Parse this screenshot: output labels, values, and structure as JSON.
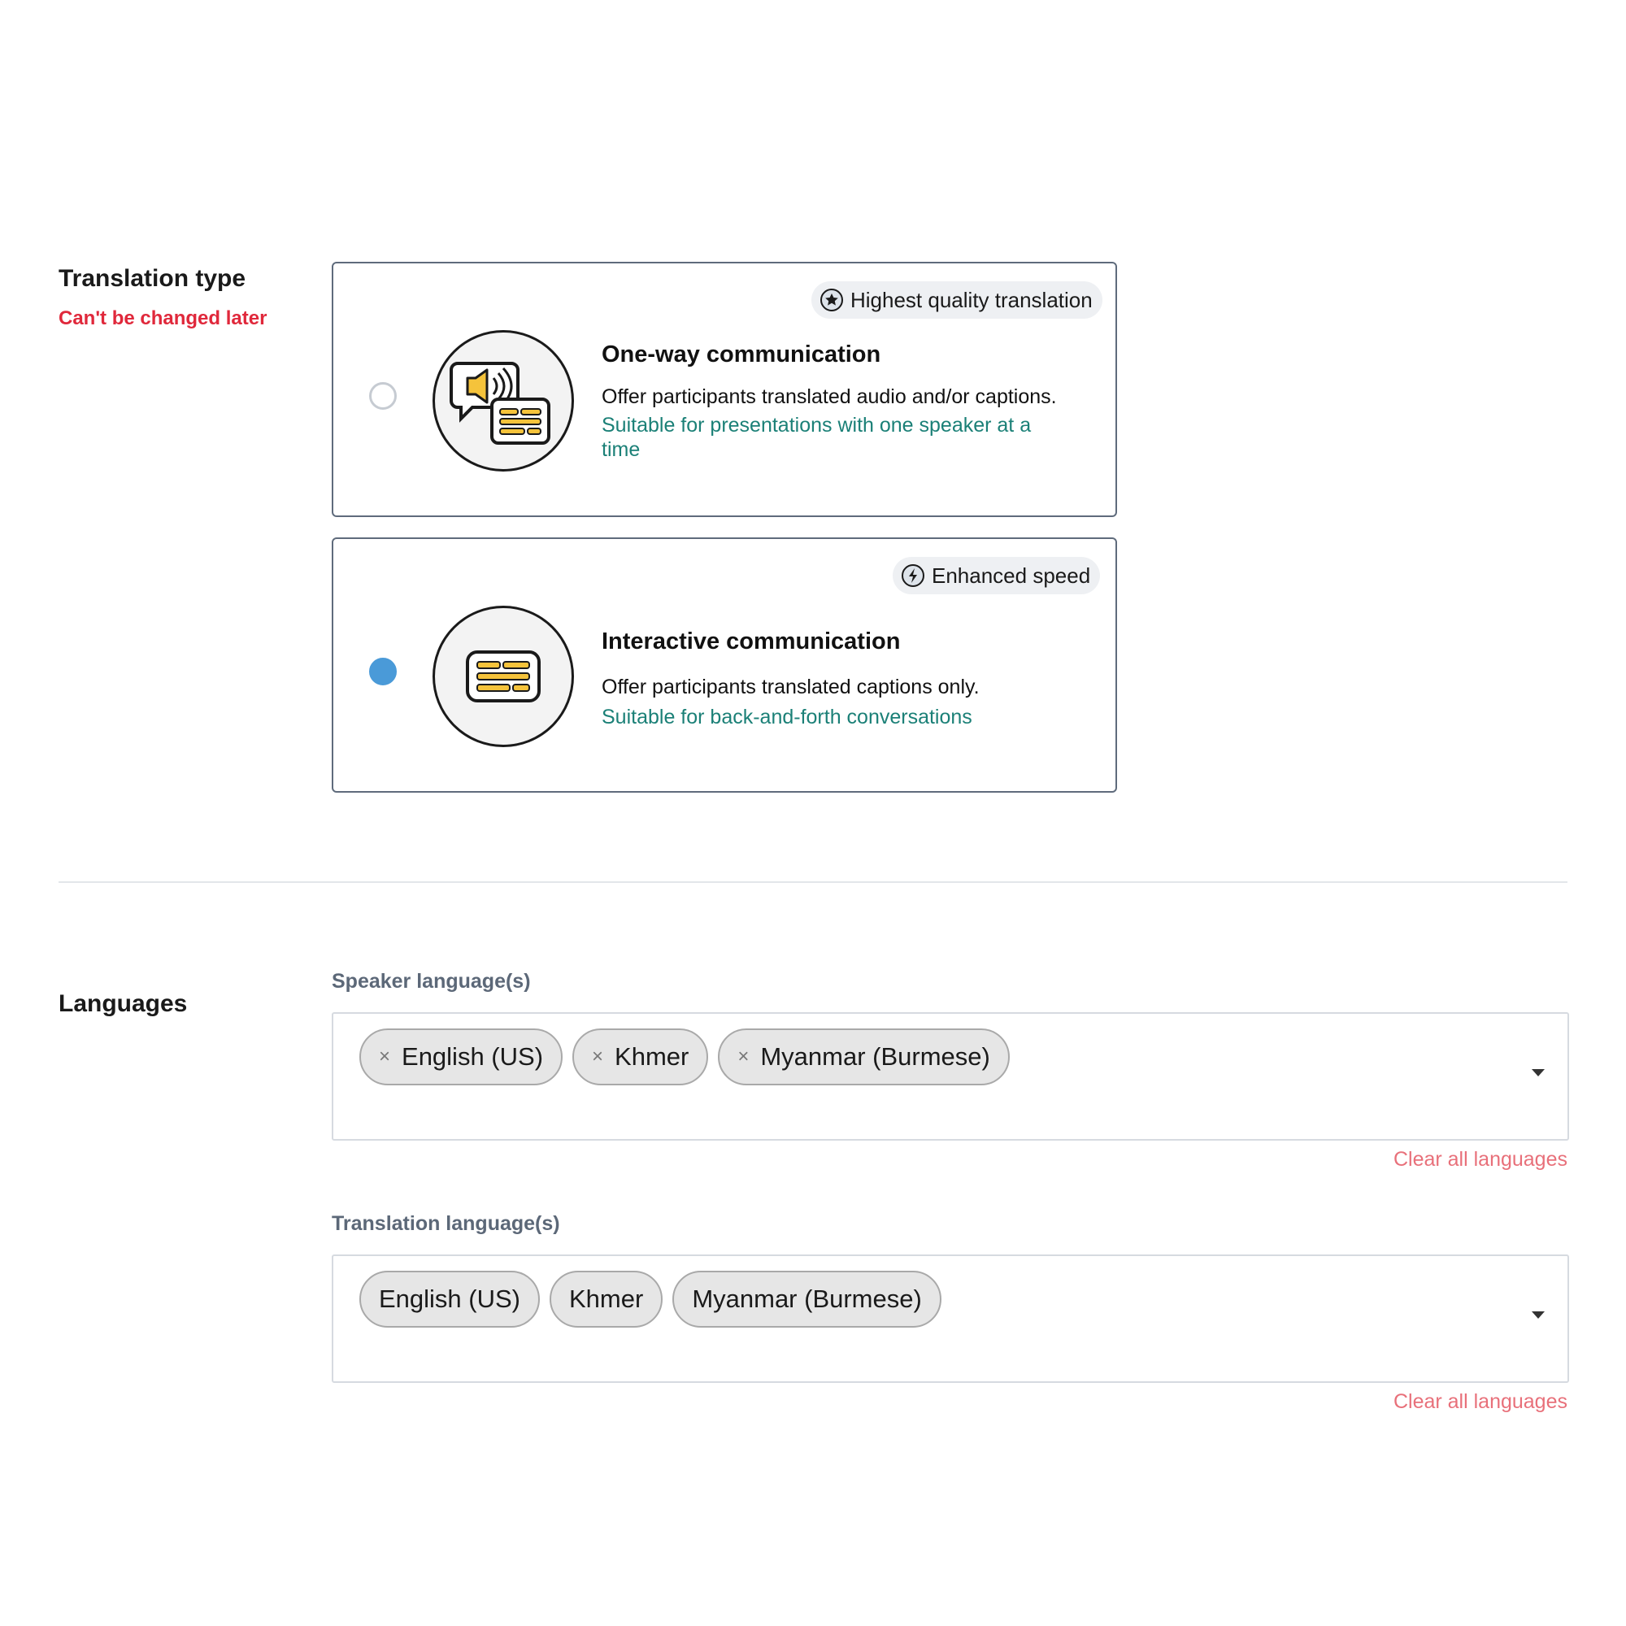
{
  "translation_type": {
    "title": "Translation type",
    "warning": "Can't be changed later",
    "options": [
      {
        "badge": "Highest quality translation",
        "badge_icon": "star-icon",
        "title": "One-way communication",
        "description": "Offer participants translated audio and/or captions.",
        "note": "Suitable for presentations with one speaker at a time",
        "selected": false
      },
      {
        "badge": "Enhanced speed",
        "badge_icon": "lightning-icon",
        "title": "Interactive communication",
        "description": "Offer participants translated captions only.",
        "note": "Suitable for back-and-forth conversations",
        "selected": true
      }
    ]
  },
  "languages": {
    "title": "Languages",
    "speaker": {
      "label": "Speaker language(s)",
      "chips": [
        "English (US)",
        "Khmer",
        "Myanmar (Burmese)"
      ],
      "remove_glyph": "×",
      "clear_label": "Clear all languages"
    },
    "translation": {
      "label": "Translation language(s)",
      "chips": [
        "English (US)",
        "Khmer",
        "Myanmar (Burmese)"
      ],
      "clear_label": "Clear all languages"
    }
  },
  "colors": {
    "accent_blue": "#4a9ad8",
    "warning_red": "#e0283b",
    "note_teal": "#1b8077",
    "clear_link": "#e8707a",
    "icon_yellow": "#f5c33b"
  }
}
